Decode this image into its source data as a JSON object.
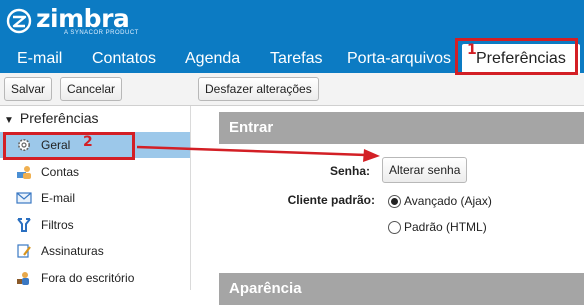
{
  "app": {
    "logo_word": "zimbra",
    "logo_sub": "A SYNACOR PRODUCT"
  },
  "nav": {
    "tabs": [
      {
        "label": "E-mail"
      },
      {
        "label": "Contatos"
      },
      {
        "label": "Agenda"
      },
      {
        "label": "Tarefas"
      },
      {
        "label": "Porta-arquivos"
      },
      {
        "label": "Preferências",
        "active": true
      }
    ]
  },
  "toolbar": {
    "save_label": "Salvar",
    "cancel_label": "Cancelar",
    "undo_label": "Desfazer alterações"
  },
  "sidebar": {
    "heading": "Preferências",
    "items": [
      {
        "label": "Geral",
        "icon": "gear-icon",
        "selected": true
      },
      {
        "label": "Contas",
        "icon": "accounts-icon"
      },
      {
        "label": "E-mail",
        "icon": "envelope-icon"
      },
      {
        "label": "Filtros",
        "icon": "filter-icon"
      },
      {
        "label": "Assinaturas",
        "icon": "signature-icon"
      },
      {
        "label": "Fora do escritório",
        "icon": "out-of-office-icon"
      }
    ]
  },
  "main": {
    "section_login": "Entrar",
    "password_label": "Senha:",
    "change_password_button": "Alterar senha",
    "default_client_label": "Cliente padrão:",
    "client_options": [
      {
        "label": "Avançado (Ajax)",
        "checked": true
      },
      {
        "label": "Padrão (HTML)",
        "checked": false
      }
    ],
    "section_appearance": "Aparência"
  },
  "annotations": {
    "step1": "1",
    "step2": "2",
    "color": "#d31f25"
  },
  "colors": {
    "brand": "#0c7bc3",
    "selected_row": "#9cc8ea",
    "section_bar": "#a5a5a5"
  }
}
